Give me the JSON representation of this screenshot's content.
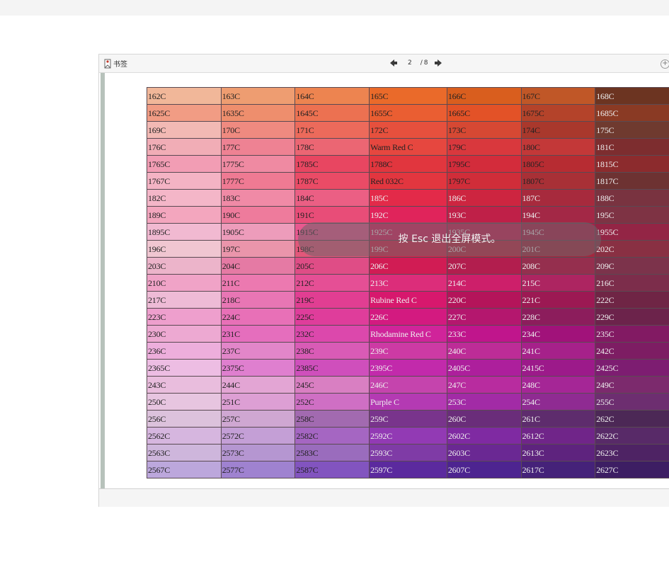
{
  "toolbar": {
    "bookmark_label": "书签",
    "current_page": "2",
    "page_separator": "/",
    "total_pages": "8"
  },
  "overlay": {
    "message": "按 Esc 退出全屏模式。"
  },
  "swatches": [
    [
      [
        "162C",
        "#f1b799",
        "#222"
      ],
      [
        "163C",
        "#ee9d71",
        "#222"
      ],
      [
        "164C",
        "#ed8450",
        "#222"
      ],
      [
        "165C",
        "#ea6a2a",
        "#222"
      ],
      [
        "166C",
        "#d95e1e",
        "#222"
      ],
      [
        "167C",
        "#c05727",
        "#222"
      ],
      [
        "168C",
        "#6c3421",
        "#eee"
      ]
    ],
    [
      [
        "1625C",
        "#f19c84",
        "#222"
      ],
      [
        "1635C",
        "#ee8e6d",
        "#222"
      ],
      [
        "1645C",
        "#ec7151",
        "#222"
      ],
      [
        "1655C",
        "#ea5e32",
        "#222"
      ],
      [
        "1665C",
        "#e35227",
        "#222"
      ],
      [
        "1675C",
        "#b4432a",
        "#222"
      ],
      [
        "1685C",
        "#8a3a24",
        "#eee"
      ]
    ],
    [
      [
        "169C",
        "#f2b9b4",
        "#222"
      ],
      [
        "170C",
        "#ef8a80",
        "#222"
      ],
      [
        "171C",
        "#ec6a5b",
        "#222"
      ],
      [
        "172C",
        "#e6503d",
        "#222"
      ],
      [
        "173C",
        "#d64833",
        "#222"
      ],
      [
        "174C",
        "#a9382c",
        "#222"
      ],
      [
        "175C",
        "#6f3a2f",
        "#eee"
      ]
    ],
    [
      [
        "176C",
        "#f1adb6",
        "#222"
      ],
      [
        "177C",
        "#ee8293",
        "#222"
      ],
      [
        "178C",
        "#eb6673",
        "#222"
      ],
      [
        "Warm Red C",
        "#e6473f",
        "#222"
      ],
      [
        "179C",
        "#d9383d",
        "#222"
      ],
      [
        "180C",
        "#c33838",
        "#222"
      ],
      [
        "181C",
        "#7d2d2f",
        "#eee"
      ]
    ],
    [
      [
        "1765C",
        "#f29db4",
        "#222"
      ],
      [
        "1775C",
        "#ef8aa2",
        "#222"
      ],
      [
        "1785C",
        "#e84661",
        "#222"
      ],
      [
        "1788C",
        "#e1363e",
        "#222"
      ],
      [
        "1795C",
        "#d32c3b",
        "#222"
      ],
      [
        "1805C",
        "#b72c32",
        "#222"
      ],
      [
        "1815C",
        "#8c2b2d",
        "#eee"
      ]
    ],
    [
      [
        "1767C",
        "#f4b3c4",
        "#222"
      ],
      [
        "1777C",
        "#ef7a93",
        "#222"
      ],
      [
        "1787C",
        "#ea4b66",
        "#222"
      ],
      [
        "Red 032C",
        "#e2363f",
        "#222"
      ],
      [
        "1797C",
        "#d02d39",
        "#222"
      ],
      [
        "1807C",
        "#a83036",
        "#222"
      ],
      [
        "1817C",
        "#6d3232",
        "#eee"
      ]
    ],
    [
      [
        "182C",
        "#f4b6c8",
        "#222"
      ],
      [
        "183C",
        "#f08aa6",
        "#222"
      ],
      [
        "184C",
        "#eb5f84",
        "#222"
      ],
      [
        "185C",
        "#e32a49",
        "#eee"
      ],
      [
        "186C",
        "#cd2540",
        "#eee"
      ],
      [
        "187C",
        "#a72a3d",
        "#eee"
      ],
      [
        "188C",
        "#793340",
        "#eee"
      ]
    ],
    [
      [
        "189C",
        "#f3a6be",
        "#222"
      ],
      [
        "190C",
        "#ee7b9c",
        "#222"
      ],
      [
        "191C",
        "#e84d78",
        "#222"
      ],
      [
        "192C",
        "#e0245b",
        "#eee"
      ],
      [
        "193C",
        "#bf2048",
        "#eee"
      ],
      [
        "194C",
        "#a32846",
        "#eee"
      ],
      [
        "195C",
        "#7e3344",
        "#eee"
      ]
    ],
    [
      [
        "1895C",
        "#f1b9d1",
        "#222"
      ],
      [
        "1905C",
        "#ed9cbb",
        "#222"
      ],
      [
        "1915C",
        "#e8588f",
        "#222"
      ],
      [
        "1925C",
        "#de1e5e",
        "#eee"
      ],
      [
        "1935C",
        "#cc1e52",
        "#eee"
      ],
      [
        "1945C",
        "#ac1f48",
        "#eee"
      ],
      [
        "1955C",
        "#932545",
        "#eee"
      ]
    ],
    [
      [
        "196C",
        "#f0c6d1",
        "#222"
      ],
      [
        "197C",
        "#ea95ab",
        "#222"
      ],
      [
        "198C",
        "#e2577a",
        "#222"
      ],
      [
        "199C",
        "#d9224b",
        "#eee"
      ],
      [
        "200C",
        "#c12440",
        "#eee"
      ],
      [
        "201C",
        "#a3283f",
        "#eee"
      ],
      [
        "202C",
        "#893043",
        "#eee"
      ]
    ],
    [
      [
        "203C",
        "#ecb4ca",
        "#222"
      ],
      [
        "204C",
        "#e57aa4",
        "#222"
      ],
      [
        "205C",
        "#df4d86",
        "#222"
      ],
      [
        "206C",
        "#d11c54",
        "#eee"
      ],
      [
        "207C",
        "#b21e4e",
        "#eee"
      ],
      [
        "208C",
        "#952f4e",
        "#eee"
      ],
      [
        "209C",
        "#7c334b",
        "#eee"
      ]
    ],
    [
      [
        "210C",
        "#f0a3c7",
        "#222"
      ],
      [
        "211C",
        "#ec79b0",
        "#222"
      ],
      [
        "212C",
        "#e54f95",
        "#222"
      ],
      [
        "213C",
        "#dc2d7a",
        "#eee"
      ],
      [
        "214C",
        "#cd1f6a",
        "#eee"
      ],
      [
        "215C",
        "#ad2561",
        "#eee"
      ],
      [
        "216C",
        "#7c2d4b",
        "#eee"
      ]
    ],
    [
      [
        "217C",
        "#eebbd6",
        "#222"
      ],
      [
        "218C",
        "#e876b4",
        "#222"
      ],
      [
        "219C",
        "#e13e92",
        "#222"
      ],
      [
        "Rubine Red C",
        "#d7186d",
        "#eee"
      ],
      [
        "220C",
        "#b4145a",
        "#eee"
      ],
      [
        "221C",
        "#9c1953",
        "#eee"
      ],
      [
        "222C",
        "#6f2545",
        "#eee"
      ]
    ],
    [
      [
        "223C",
        "#ee9fcd",
        "#222"
      ],
      [
        "224C",
        "#e870b7",
        "#222"
      ],
      [
        "225C",
        "#df3d9b",
        "#222"
      ],
      [
        "226C",
        "#d31a80",
        "#eee"
      ],
      [
        "227C",
        "#b4176e",
        "#eee"
      ],
      [
        "228C",
        "#8c1d5c",
        "#eee"
      ],
      [
        "229C",
        "#6c234b",
        "#eee"
      ]
    ],
    [
      [
        "230C",
        "#eda9d2",
        "#222"
      ],
      [
        "231C",
        "#e56ebd",
        "#222"
      ],
      [
        "232C",
        "#dc48ac",
        "#222"
      ],
      [
        "Rhodamine Red C",
        "#d0249a",
        "#eee"
      ],
      [
        "233C",
        "#c0158c",
        "#eee"
      ],
      [
        "234C",
        "#a1127a",
        "#eee"
      ],
      [
        "235C",
        "#821a63",
        "#eee"
      ]
    ],
    [
      [
        "236C",
        "#edaedc",
        "#222"
      ],
      [
        "237C",
        "#e286c9",
        "#222"
      ],
      [
        "238C",
        "#d95bb6",
        "#222"
      ],
      [
        "239C",
        "#cd3aa4",
        "#eee"
      ],
      [
        "240C",
        "#bd2c97",
        "#eee"
      ],
      [
        "241C",
        "#a6218a",
        "#eee"
      ],
      [
        "242C",
        "#7d1d63",
        "#eee"
      ]
    ],
    [
      [
        "2365C",
        "#edbde3",
        "#222"
      ],
      [
        "2375C",
        "#df7fcf",
        "#222"
      ],
      [
        "2385C",
        "#cf4fbc",
        "#222"
      ],
      [
        "2395C",
        "#c22aab",
        "#eee"
      ],
      [
        "2405C",
        "#ad1f9c",
        "#eee"
      ],
      [
        "2415C",
        "#9c1a8a",
        "#eee"
      ],
      [
        "2425C",
        "#7d1d71",
        "#eee"
      ]
    ],
    [
      [
        "243C",
        "#e9bddd",
        "#222"
      ],
      [
        "244C",
        "#e3a5d4",
        "#222"
      ],
      [
        "245C",
        "#d97fc2",
        "#222"
      ],
      [
        "246C",
        "#c544ad",
        "#eee"
      ],
      [
        "247C",
        "#b82c9f",
        "#eee"
      ],
      [
        "248C",
        "#a52696",
        "#eee"
      ],
      [
        "249C",
        "#7c2a6d",
        "#eee"
      ]
    ],
    [
      [
        "250C",
        "#e7c5e0",
        "#222"
      ],
      [
        "251C",
        "#dd9fd4",
        "#222"
      ],
      [
        "252C",
        "#cf6fc4",
        "#222"
      ],
      [
        "Purple C",
        "#b43ab3",
        "#eee"
      ],
      [
        "253C",
        "#a22ba6",
        "#eee"
      ],
      [
        "254C",
        "#8f2b92",
        "#eee"
      ],
      [
        "255C",
        "#6d2e70",
        "#eee"
      ]
    ],
    [
      [
        "256C",
        "#dcc2dc",
        "#222"
      ],
      [
        "257C",
        "#cfa7d2",
        "#222"
      ],
      [
        "258C",
        "#a26ab0",
        "#222"
      ],
      [
        "259C",
        "#79348c",
        "#eee"
      ],
      [
        "260C",
        "#6a2d7a",
        "#eee"
      ],
      [
        "261C",
        "#5e2c6d",
        "#eee"
      ],
      [
        "262C",
        "#4c2856",
        "#eee"
      ]
    ],
    [
      [
        "2562C",
        "#d6b6df",
        "#222"
      ],
      [
        "2572C",
        "#c49fd6",
        "#222"
      ],
      [
        "2582C",
        "#a566c2",
        "#222"
      ],
      [
        "2592C",
        "#923ab4",
        "#eee"
      ],
      [
        "2602C",
        "#7f2aa2",
        "#eee"
      ],
      [
        "2612C",
        "#702589",
        "#eee"
      ],
      [
        "2622C",
        "#582a68",
        "#eee"
      ]
    ],
    [
      [
        "2563C",
        "#ceb6dc",
        "#222"
      ],
      [
        "2573C",
        "#b596d1",
        "#222"
      ],
      [
        "2583C",
        "#9a6cbd",
        "#222"
      ],
      [
        "2593C",
        "#7f3ba6",
        "#eee"
      ],
      [
        "2603C",
        "#6a2893",
        "#eee"
      ],
      [
        "2613C",
        "#5e237e",
        "#eee"
      ],
      [
        "2623C",
        "#4e2364",
        "#eee"
      ]
    ],
    [
      [
        "2567C",
        "#bca7dc",
        "#222"
      ],
      [
        "2577C",
        "#9f82d0",
        "#222"
      ],
      [
        "2587C",
        "#8254bf",
        "#222"
      ],
      [
        "2597C",
        "#5b2a9e",
        "#eee"
      ],
      [
        "2607C",
        "#4d2490",
        "#eee"
      ],
      [
        "2617C",
        "#452279",
        "#eee"
      ],
      [
        "2627C",
        "#3d1e63",
        "#eee"
      ]
    ]
  ]
}
